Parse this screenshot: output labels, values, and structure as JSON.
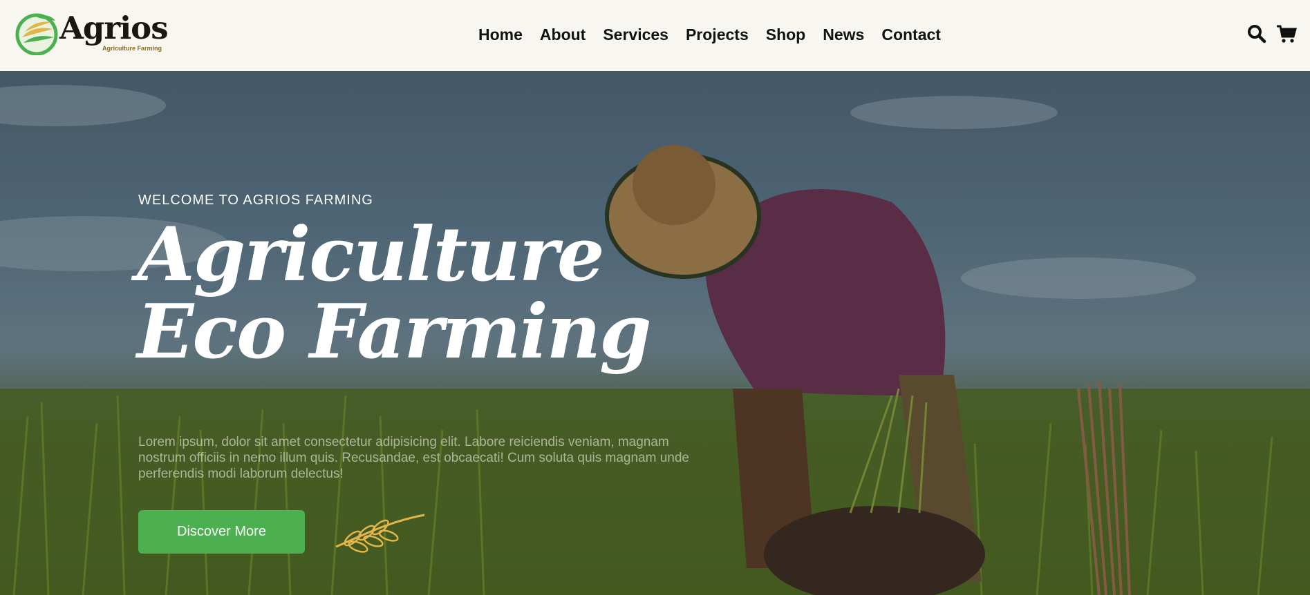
{
  "header": {
    "logo": {
      "name": "Agrios",
      "tagline": "Agriculture Farming"
    },
    "nav": [
      {
        "label": "Home"
      },
      {
        "label": "About"
      },
      {
        "label": "Services"
      },
      {
        "label": "Projects"
      },
      {
        "label": "Shop"
      },
      {
        "label": "News"
      },
      {
        "label": "Contact"
      }
    ],
    "icons": {
      "search": "search-icon",
      "cart": "cart-icon"
    }
  },
  "hero": {
    "eyebrow": "WELCOME TO AGRIOS FARMING",
    "title_line1": "Agriculture",
    "title_line2": "Eco Farming",
    "description": "Lorem ipsum, dolor sit amet consectetur adipisicing elit. Labore reiciendis veniam, magnam nostrum officiis in nemo illum quis. Recusandae, est obcaecati! Cum soluta quis magnam unde perferendis modi laborum delectus!",
    "cta_label": "Discover More"
  },
  "colors": {
    "accent_green": "#4caf50",
    "header_bg": "#f8f6f0",
    "text_dark": "#111111",
    "gold": "#e2b64a"
  }
}
